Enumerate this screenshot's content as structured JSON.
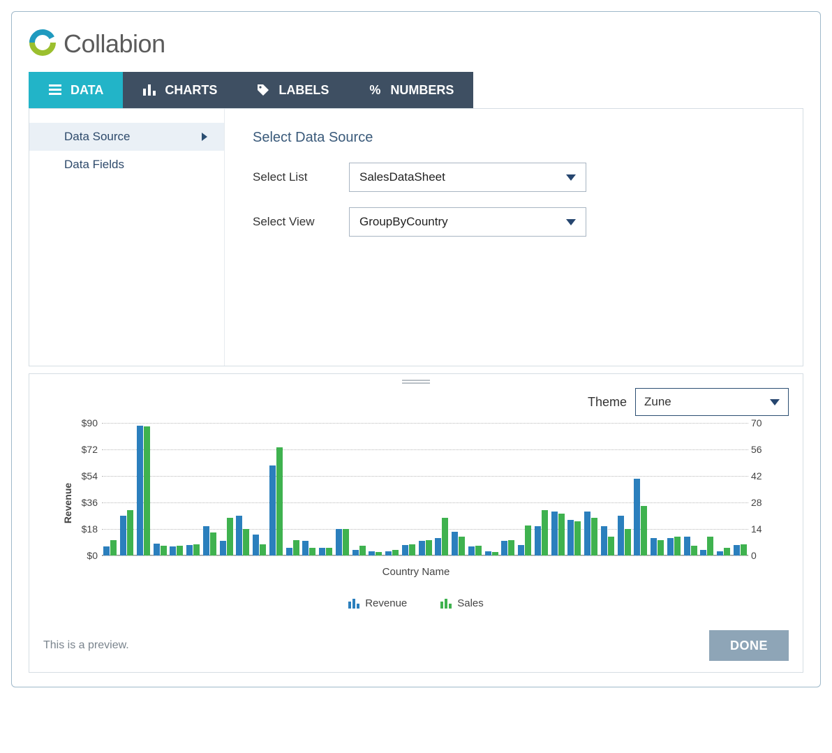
{
  "brand": {
    "name": "Collabion"
  },
  "tabs": [
    {
      "id": "data",
      "label": "DATA",
      "active": true,
      "icon": "menu-icon"
    },
    {
      "id": "charts",
      "label": "CHARTS",
      "active": false,
      "icon": "bars-icon"
    },
    {
      "id": "labels",
      "label": "LABELS",
      "active": false,
      "icon": "tag-icon"
    },
    {
      "id": "numbers",
      "label": "NUMBERS",
      "active": false,
      "icon": "percent-icon"
    }
  ],
  "sidebar": {
    "items": [
      {
        "label": "Data Source",
        "active": true
      },
      {
        "label": "Data Fields",
        "active": false
      }
    ]
  },
  "content": {
    "section_title": "Select Data Source",
    "list_label": "Select List",
    "list_value": "SalesDataSheet",
    "view_label": "Select View",
    "view_value": "GroupByCountry"
  },
  "preview": {
    "theme_label": "Theme",
    "theme_value": "Zune",
    "note": "This is a preview.",
    "done_label": "DONE"
  },
  "chart_data": {
    "type": "bar",
    "xlabel": "Country Name",
    "y_left_label": "Revenue",
    "y_left_ticks": [
      "$0",
      "$18",
      "$36",
      "$54",
      "$72",
      "$90"
    ],
    "y_left_range": [
      0,
      90
    ],
    "y_right_ticks": [
      "0",
      "14",
      "28",
      "42",
      "56",
      "70"
    ],
    "y_right_range": [
      0,
      70
    ],
    "series": [
      {
        "name": "Revenue",
        "axis": "left",
        "color": "#2b7fbd",
        "values": [
          6,
          27,
          88,
          8,
          6,
          7,
          20,
          10,
          27,
          14,
          61,
          5,
          10,
          5,
          18,
          4,
          3,
          3,
          7,
          10,
          12,
          16,
          6,
          3,
          10,
          7,
          20,
          30,
          24,
          30,
          20,
          27,
          52,
          12,
          12,
          13,
          4,
          3,
          7
        ]
      },
      {
        "name": "Sales",
        "axis": "right",
        "color": "#3fb24f",
        "values": [
          8,
          24,
          68,
          5,
          5,
          6,
          12,
          20,
          14,
          6,
          57,
          8,
          4,
          4,
          14,
          5,
          2,
          3,
          6,
          8,
          20,
          10,
          5,
          2,
          8,
          16,
          24,
          22,
          18,
          20,
          10,
          14,
          26,
          8,
          10,
          5,
          10,
          4,
          6
        ]
      }
    ],
    "legend": [
      "Revenue",
      "Sales"
    ]
  }
}
